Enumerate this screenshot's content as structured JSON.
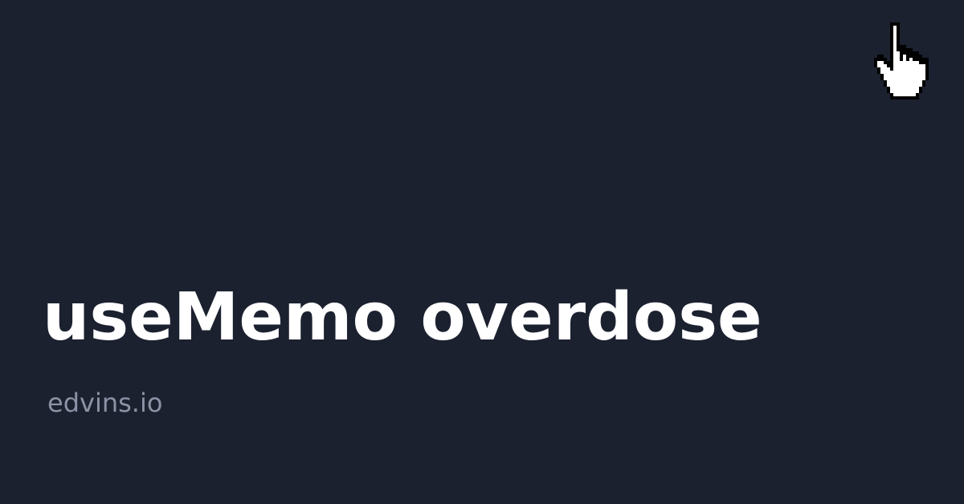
{
  "page": {
    "title": "useMemo overdose",
    "site": "edvins.io"
  },
  "icons": {
    "cursor": "pointing-hand-cursor-icon"
  },
  "colors": {
    "background": "#1c2130",
    "title": "#ffffff",
    "site": "#8b93a5",
    "cursor_fill": "#ffffff",
    "cursor_outline": "#000000"
  }
}
